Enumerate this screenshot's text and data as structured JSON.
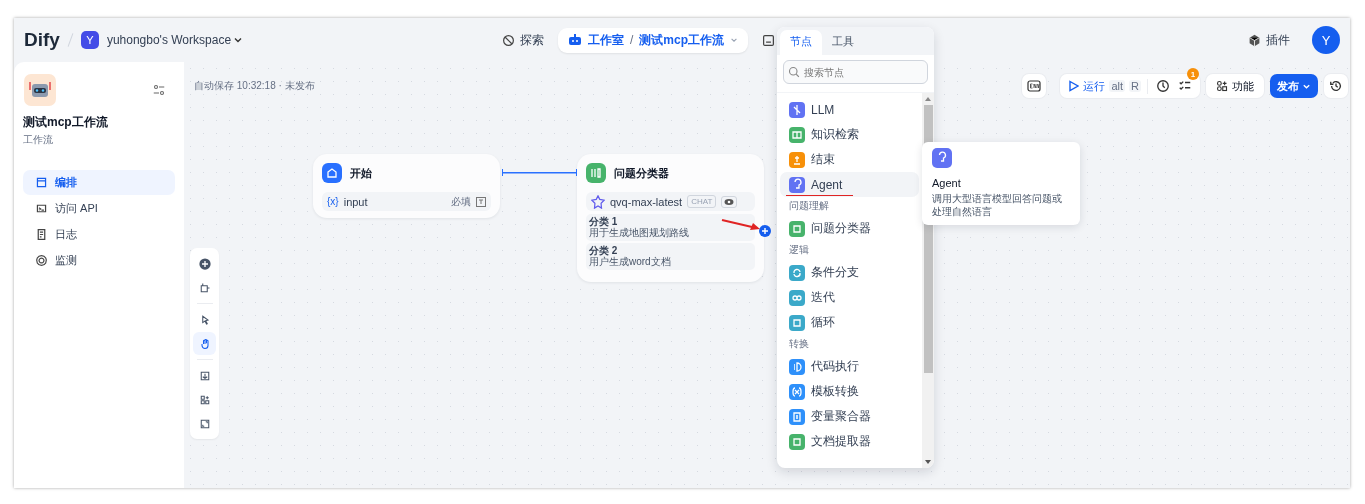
{
  "header": {
    "logo": "Dify",
    "workspace": {
      "avatar": "Y",
      "name": "yuhongbo's Workspace"
    },
    "nav": [
      {
        "label": "探索"
      }
    ],
    "studio": {
      "label": "工作室",
      "separator": "/",
      "app": "测试mcp工作流"
    },
    "plugins": "插件",
    "user_avatar": "Y"
  },
  "sidebar": {
    "app_name": "测试mcp工作流",
    "app_type": "工作流",
    "items": [
      {
        "label": "编排",
        "selected": true
      },
      {
        "label": "访问 API",
        "selected": false
      },
      {
        "label": "日志",
        "selected": false
      },
      {
        "label": "监测",
        "selected": false
      }
    ]
  },
  "canvas": {
    "autosave": "自动保存 10:32:18 · 未发布",
    "toolbar": {
      "run": "运行",
      "shortcut": [
        "alt",
        "R"
      ],
      "badge": "1",
      "features": "功能",
      "publish": "发布"
    },
    "nodes": [
      {
        "kind": "start",
        "title": "开始",
        "vars": [
          {
            "type_mark": "{x}",
            "name": "input",
            "required": "必填"
          }
        ]
      },
      {
        "kind": "classifier",
        "title": "问题分类器",
        "model": "qvq-max-latest",
        "model_tag": "CHAT",
        "classes": [
          {
            "label": "分类 1",
            "text": "用于生成地图规划路线"
          },
          {
            "label": "分类 2",
            "text": "用户生成word文档"
          }
        ]
      }
    ],
    "tools": [
      {
        "selected": false
      },
      {
        "selected": false
      },
      {
        "selected": false
      },
      {
        "selected": true
      },
      {
        "selected": false
      },
      {
        "selected": false
      },
      {
        "selected": false
      }
    ]
  },
  "node_picker": {
    "tabs": [
      {
        "label": "节点",
        "selected": true
      },
      {
        "label": "工具",
        "selected": false
      }
    ],
    "search_placeholder": "搜索节点",
    "items": [
      {
        "kind": "item",
        "label": "LLM",
        "color": "#6172f3",
        "highlighted": false,
        "underlined": false
      },
      {
        "kind": "item",
        "label": "知识检索",
        "color": "#47b36b",
        "highlighted": false,
        "underlined": false
      },
      {
        "kind": "item",
        "label": "结束",
        "color": "#f79009",
        "highlighted": false,
        "underlined": false
      },
      {
        "kind": "item",
        "label": "Agent",
        "color": "#6172f3",
        "highlighted": true,
        "underlined": true
      },
      {
        "kind": "heading",
        "label": "问题理解"
      },
      {
        "kind": "item",
        "label": "问题分类器",
        "color": "#47b36b",
        "highlighted": false,
        "underlined": false
      },
      {
        "kind": "heading",
        "label": "逻辑"
      },
      {
        "kind": "item",
        "label": "条件分支",
        "color": "#3ba9c9",
        "highlighted": false,
        "underlined": false
      },
      {
        "kind": "item",
        "label": "迭代",
        "color": "#3ba9c9",
        "highlighted": false,
        "underlined": false
      },
      {
        "kind": "item",
        "label": "循环",
        "color": "#3ba9c9",
        "highlighted": false,
        "underlined": false
      },
      {
        "kind": "heading",
        "label": "转换"
      },
      {
        "kind": "item",
        "label": "代码执行",
        "color": "#2e90fa",
        "highlighted": false,
        "underlined": false
      },
      {
        "kind": "item",
        "label": "模板转换",
        "color": "#2e90fa",
        "highlighted": false,
        "underlined": false
      },
      {
        "kind": "item",
        "label": "变量聚合器",
        "color": "#2e90fa",
        "highlighted": false,
        "underlined": false
      },
      {
        "kind": "item",
        "label": "文档提取器",
        "color": "#47b36b",
        "highlighted": false,
        "underlined": false
      }
    ]
  },
  "tooltip": {
    "title": "Agent",
    "description": "调用大型语言模型回答问题或处理自然语言",
    "color": "#6172f3"
  }
}
